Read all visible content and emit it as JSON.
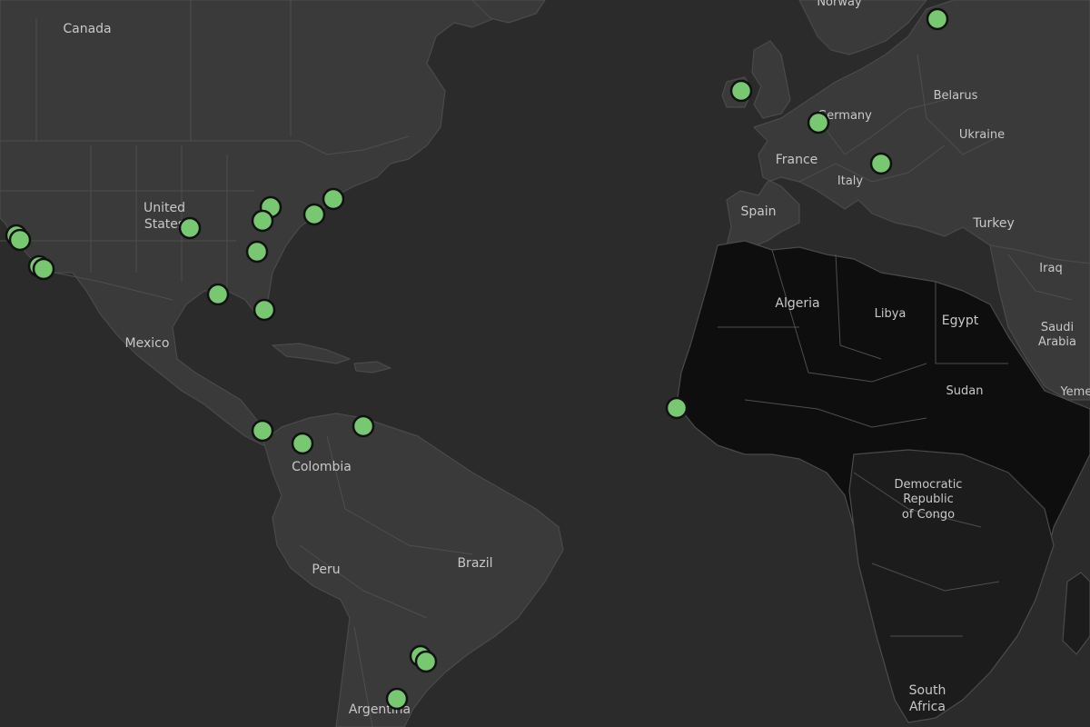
{
  "map": {
    "marker_color": "#78c872",
    "marker_outline": "#111111",
    "labels": [
      {
        "id": "canada",
        "text": "Canada"
      },
      {
        "id": "united-states-1",
        "text": "United"
      },
      {
        "id": "united-states-2",
        "text": "States"
      },
      {
        "id": "mexico",
        "text": "Mexico"
      },
      {
        "id": "colombia",
        "text": "Colombia"
      },
      {
        "id": "peru",
        "text": "Peru"
      },
      {
        "id": "brazil",
        "text": "Brazil"
      },
      {
        "id": "argentina",
        "text": "Argentina"
      },
      {
        "id": "norway",
        "text": "Norway"
      },
      {
        "id": "belarus",
        "text": "Belarus"
      },
      {
        "id": "germany",
        "text": "Germany"
      },
      {
        "id": "ukraine",
        "text": "Ukraine"
      },
      {
        "id": "france",
        "text": "France"
      },
      {
        "id": "italy",
        "text": "Italy"
      },
      {
        "id": "spain",
        "text": "Spain"
      },
      {
        "id": "turkey",
        "text": "Turkey"
      },
      {
        "id": "iraq",
        "text": "Iraq"
      },
      {
        "id": "algeria",
        "text": "Algeria"
      },
      {
        "id": "libya",
        "text": "Libya"
      },
      {
        "id": "egypt",
        "text": "Egypt"
      },
      {
        "id": "saudi-1",
        "text": "Saudi"
      },
      {
        "id": "saudi-2",
        "text": "Arabia"
      },
      {
        "id": "sudan",
        "text": "Sudan"
      },
      {
        "id": "yemen",
        "text": "Yemen"
      },
      {
        "id": "drc-1",
        "text": "Democratic"
      },
      {
        "id": "drc-2",
        "text": "Republic"
      },
      {
        "id": "drc-3",
        "text": "of Congo"
      },
      {
        "id": "south-africa-1",
        "text": "South"
      },
      {
        "id": "south-africa-2",
        "text": "Africa"
      }
    ]
  }
}
